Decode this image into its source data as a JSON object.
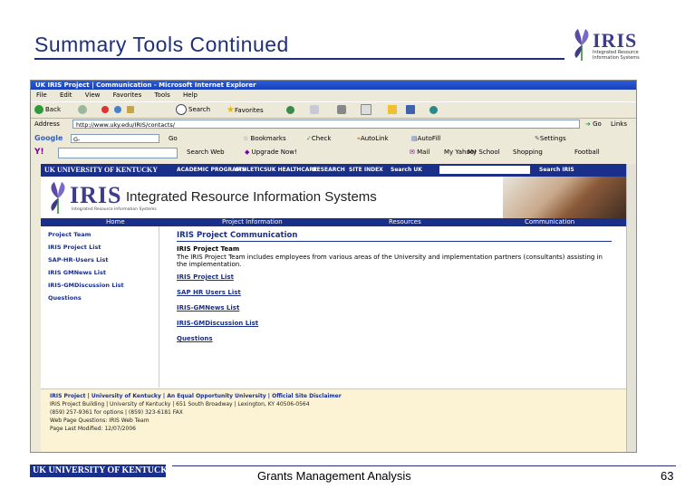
{
  "slide": {
    "title": "Summary Tools Continued",
    "footer_text": "Grants Management Analysis",
    "page_number": "63",
    "logo_text": "IRIS",
    "logo_sub": "Integrated Resource Information Systems",
    "uk_logo_text": "UK UNIVERSITY OF KENTUCKY"
  },
  "browser": {
    "window_title": "UK IRIS Project | Communication - Microsoft Internet Explorer",
    "menu": [
      "File",
      "Edit",
      "View",
      "Favorites",
      "Tools",
      "Help"
    ],
    "toolbar": {
      "back": "Back",
      "search": "Search",
      "favorites": "Favorites"
    },
    "address_label": "Address",
    "address": "http://www.uky.edu/IRIS/contacts/",
    "go_label": "Go",
    "links_label": "Links",
    "google": {
      "brand": "Google",
      "g_value": "G-",
      "go": "Go",
      "bookmarks": "Bookmarks",
      "check": "Check",
      "autolink": "AutoLink",
      "autofill": "AutoFill",
      "settings": "Settings"
    },
    "yahoo": {
      "brand": "Y!",
      "search_web": "Search Web",
      "upgrade": "Upgrade Now!",
      "mail": "Mail",
      "my_yahoo": "My Yahoo!",
      "myschool": "My School",
      "shopping": "Shopping",
      "football": "Football"
    }
  },
  "webpage": {
    "uk_bar": {
      "brand": "UK UNIVERSITY OF KENTUCKY",
      "items": [
        "ACADEMIC PROGRAMS",
        "ATHLETICS",
        "UK HEALTHCARE",
        "RESEARCH",
        "SITE INDEX"
      ],
      "search_label": "Search UK",
      "search_button": "Search IRIS"
    },
    "banner": {
      "iris": "IRIS",
      "iris_sub": "Integrated Resource Information Systems",
      "long_name": "Integrated Resource Information Systems"
    },
    "nav": [
      "Home",
      "Project Information",
      "Resources",
      "Communication"
    ],
    "sidebar": [
      "Project Team",
      "IRIS Project List",
      "SAP-HR-Users List",
      "IRIS GMNews List",
      "IRIS-GMDiscussion List",
      "Questions"
    ],
    "content": {
      "heading": "IRIS Project Communication",
      "team_heading": "IRIS Project Team",
      "team_desc": "The IRIS Project Team includes employees from various areas of the University and implementation partners (consultants) assisting in the implementation.",
      "links": [
        "IRIS Project List",
        "SAP HR Users List",
        "IRIS-GMNews List",
        "IRIS-GMDiscussion List",
        "Questions"
      ]
    },
    "footer": [
      "IRIS Project | University of Kentucky | An Equal Opportunity University | Official Site Disclaimer",
      "IRIS Project Building | University of Kentucky | 651 South Broadway | Lexington, KY 40506-0564",
      "(859) 257-9361 for options | (859) 323-6181 FAX",
      "Web Page Questions: IRIS Web Team",
      "Page Last Modified: 12/07/2006"
    ]
  }
}
